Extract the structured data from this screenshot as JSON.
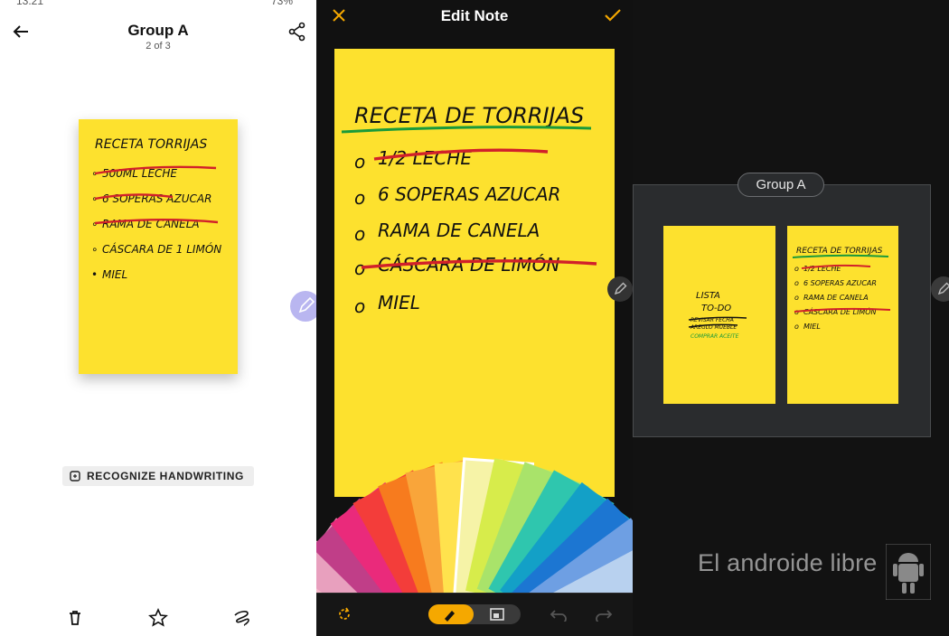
{
  "panel1": {
    "status_time": "13:21",
    "status_battery": "73%",
    "title": "Group A",
    "subtitle": "2 of 3",
    "note": {
      "title": "RECETA TORRIJAS",
      "items": [
        "500ML LECHE",
        "6 SOPERAS AZUCAR",
        "RAMA DE CANELA",
        "CÁSCARA DE 1 LIMÓN",
        "MIEL"
      ]
    },
    "recognize_label": "RECOGNIZE HANDWRITING"
  },
  "panel2": {
    "title": "Edit Note",
    "note": {
      "title": "RECETA DE TORRIJAS",
      "items": [
        "1/2 LECHE",
        "6 SOPERAS AZUCAR",
        "RAMA DE CANELA",
        "CÁSCARA DE LIMÓN",
        "MIEL"
      ]
    },
    "fan_colors": [
      "#f5b8c9",
      "#e8a0be",
      "#c03e88",
      "#ea2a7b",
      "#f33d3a",
      "#f77b1e",
      "#f9a53a",
      "#ffe24d",
      "#f6f3a7",
      "#d7ec4b",
      "#a9e36a",
      "#2fc6ae",
      "#13a0c7",
      "#1c76d2",
      "#6e9fe3",
      "#b8d1ef"
    ],
    "accent": "#f5a800"
  },
  "panel3": {
    "group_label": "Group A",
    "mini1": {
      "title": "LISTA",
      "subtitle": "TO-DO",
      "items": [
        "REVISAR FECHA",
        "AREGLO MUEBLE",
        "COMPRAR ACEITE"
      ]
    },
    "mini2": {
      "title": "RECETA DE TORRIJAS",
      "items": [
        "1/2 LECHE",
        "6 SOPERAS AZUCAR",
        "RAMA DE CANELA",
        "CÁSCARA DE LIMÓN",
        "MIEL"
      ]
    },
    "watermark": "El androide libre"
  }
}
